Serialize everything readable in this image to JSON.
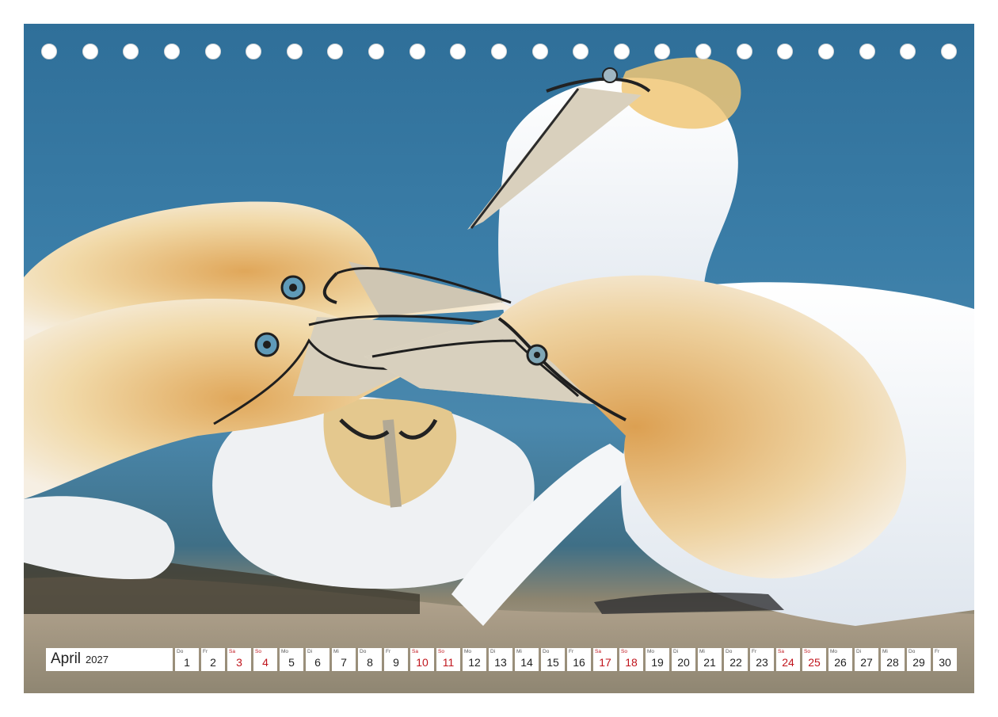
{
  "calendar": {
    "month": "April",
    "year": "2027",
    "days": [
      {
        "wd": "Do",
        "num": "1",
        "weekend": false
      },
      {
        "wd": "Fr",
        "num": "2",
        "weekend": false
      },
      {
        "wd": "Sa",
        "num": "3",
        "weekend": true
      },
      {
        "wd": "So",
        "num": "4",
        "weekend": true
      },
      {
        "wd": "Mo",
        "num": "5",
        "weekend": false
      },
      {
        "wd": "Di",
        "num": "6",
        "weekend": false
      },
      {
        "wd": "Mi",
        "num": "7",
        "weekend": false
      },
      {
        "wd": "Do",
        "num": "8",
        "weekend": false
      },
      {
        "wd": "Fr",
        "num": "9",
        "weekend": false
      },
      {
        "wd": "Sa",
        "num": "10",
        "weekend": true
      },
      {
        "wd": "So",
        "num": "11",
        "weekend": true
      },
      {
        "wd": "Mo",
        "num": "12",
        "weekend": false
      },
      {
        "wd": "Di",
        "num": "13",
        "weekend": false
      },
      {
        "wd": "Mi",
        "num": "14",
        "weekend": false
      },
      {
        "wd": "Do",
        "num": "15",
        "weekend": false
      },
      {
        "wd": "Fr",
        "num": "16",
        "weekend": false
      },
      {
        "wd": "Sa",
        "num": "17",
        "weekend": true
      },
      {
        "wd": "So",
        "num": "18",
        "weekend": true
      },
      {
        "wd": "Mo",
        "num": "19",
        "weekend": false
      },
      {
        "wd": "Di",
        "num": "20",
        "weekend": false
      },
      {
        "wd": "Mi",
        "num": "21",
        "weekend": false
      },
      {
        "wd": "Do",
        "num": "22",
        "weekend": false
      },
      {
        "wd": "Fr",
        "num": "23",
        "weekend": false
      },
      {
        "wd": "Sa",
        "num": "24",
        "weekend": true
      },
      {
        "wd": "So",
        "num": "25",
        "weekend": true
      },
      {
        "wd": "Mo",
        "num": "26",
        "weekend": false
      },
      {
        "wd": "Di",
        "num": "27",
        "weekend": false
      },
      {
        "wd": "Mi",
        "num": "28",
        "weekend": false
      },
      {
        "wd": "Do",
        "num": "29",
        "weekend": false
      },
      {
        "wd": "Fr",
        "num": "30",
        "weekend": false
      }
    ]
  },
  "colors": {
    "weekend": "#c0141c",
    "background_sea": "#3b7ea8",
    "gannet_head": "#e9c27a"
  },
  "binding_holes": 23
}
